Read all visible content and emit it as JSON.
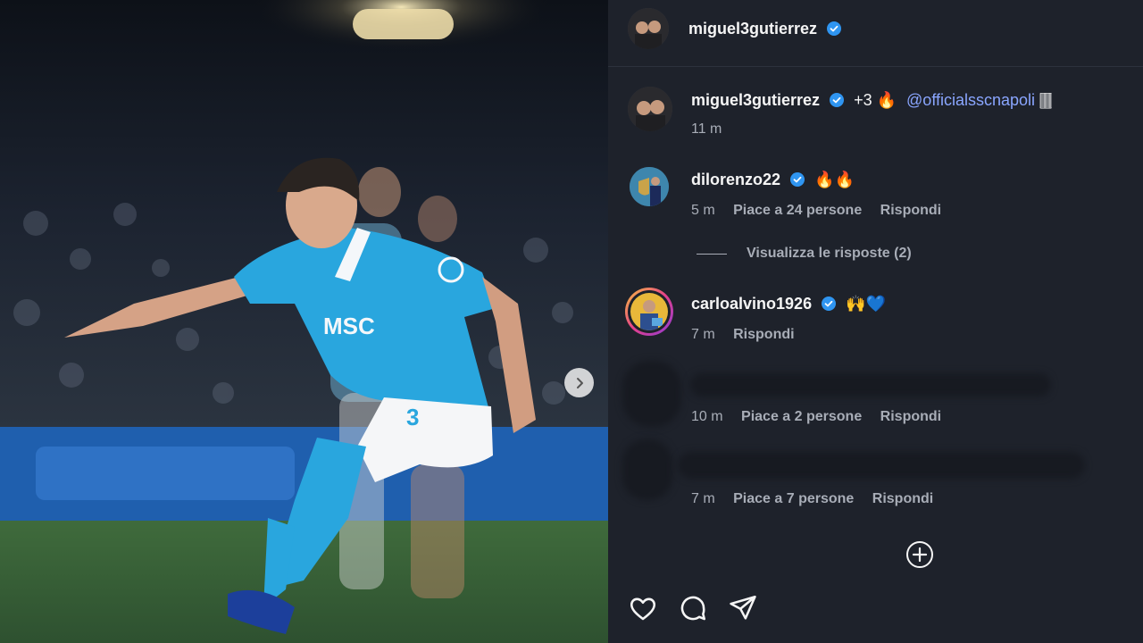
{
  "photo": {
    "alt_icon": "photo-of-footballer",
    "jersey_sponsor": "MSC",
    "jersey_number": "3",
    "next_icon": "chevron-right-icon"
  },
  "header": {
    "username": "miguel3gutierrez",
    "verified_icon": "verified-badge-icon"
  },
  "caption": {
    "username": "miguel3gutierrez",
    "text_prefix": "+3 🔥",
    "mention": "@officialsscnapoli",
    "text_suffix": " 🀫",
    "time": "11 m"
  },
  "comments": [
    {
      "username": "dilorenzo22",
      "text": "🔥🔥",
      "time": "5 m",
      "likes": "Piace a 24 persone",
      "reply": "Rispondi"
    },
    {
      "username": "carloalvino1926",
      "text": "🙌💙",
      "time": "7 m",
      "reply": "Rispondi"
    },
    {
      "username": "",
      "text": "",
      "time": "10 m",
      "likes": "Piace a 2 persone",
      "reply": "Rispondi"
    },
    {
      "username": "",
      "text": "",
      "time": "7 m",
      "likes": "Piace a 7 persone",
      "reply": "Rispondi"
    }
  ],
  "view_replies": "Visualizza le risposte (2)",
  "actions": {
    "like_icon": "heart-icon",
    "comment_icon": "comment-icon",
    "share_icon": "send-icon",
    "add_icon": "plus-circle-icon"
  }
}
